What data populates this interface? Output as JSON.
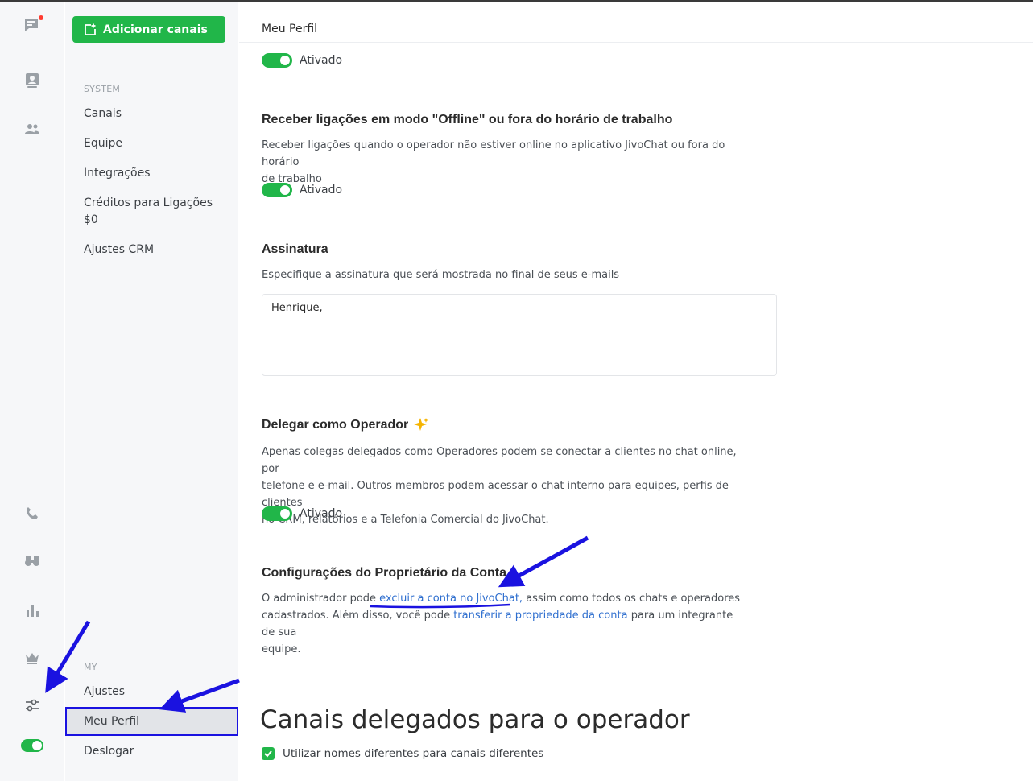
{
  "colors": {
    "accent": "#21b649",
    "link": "#2f6fcf",
    "annotation": "#1a12e0",
    "notification": "#ff3b30"
  },
  "rail": {
    "icons": [
      "chat-icon",
      "contacts-icon",
      "team-icon",
      "phone-icon",
      "binoculars-icon",
      "stats-icon",
      "crown-icon",
      "settings-sliders-icon"
    ],
    "status_toggle_on": true
  },
  "sidebar": {
    "add_button": "Adicionar canais",
    "system_label": "SYSTEM",
    "system_items": [
      {
        "label": "Canais"
      },
      {
        "label": "Equipe"
      },
      {
        "label": "Integrações"
      },
      {
        "label": "Créditos para Ligações",
        "sub": "$0"
      },
      {
        "label": "Ajustes CRM"
      }
    ],
    "my_label": "MY",
    "my_items": [
      {
        "label": "Ajustes"
      },
      {
        "label": "Meu Perfil",
        "active": true
      },
      {
        "label": "Deslogar"
      }
    ]
  },
  "main": {
    "header_title": "Meu Perfil",
    "toggle1": {
      "label": "Ativado",
      "on": true
    },
    "offline": {
      "title": "Receber ligações em modo \"Offline\" ou fora do horário de trabalho",
      "desc_1": "Receber ligações quando o operador não estiver online no aplicativo JivoChat ou fora do horário",
      "desc_2": "de trabalho",
      "toggle_label": "Ativado"
    },
    "signature": {
      "title": "Assinatura",
      "desc": "Especifique a assinatura que será mostrada no final de seus e-mails",
      "value": "Henrique,"
    },
    "delegate": {
      "title": "Delegar como Operador",
      "desc_1": "Apenas colegas delegados como Operadores podem se conectar a clientes no chat online, por",
      "desc_2": "telefone e e-mail. Outros membros podem acessar o chat interno para equipes, perfis de clientes",
      "desc_3": "no CRM, relatórios e a Telefonia Comercial do JivoChat.",
      "toggle_label": "Ativado"
    },
    "owner": {
      "title": "Configurações do Proprietário da Conta",
      "line1_pre": "O administrador pode ",
      "line1_link": "excluir a conta no JivoChat,",
      "line1_post": " assim como todos os chats e operadores",
      "line2_pre": "cadastrados. Além disso, você pode ",
      "line2_link": "transferir a propriedade da conta",
      "line2_post": " para um integrante de sua",
      "line3": "equipe."
    },
    "channels": {
      "title": "Canais delegados para o operador",
      "checkbox_label": "Utilizar nomes diferentes para canais diferentes",
      "checked": true
    }
  }
}
